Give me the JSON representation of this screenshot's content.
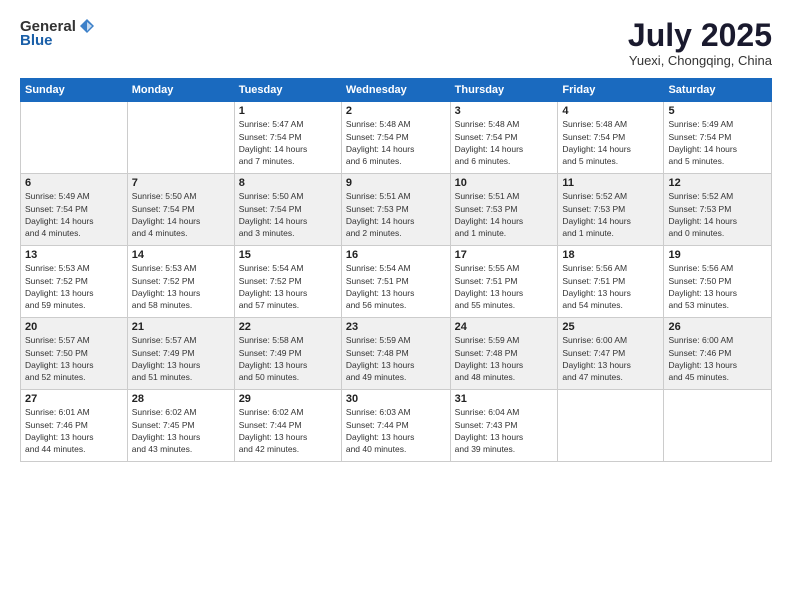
{
  "header": {
    "logo_general": "General",
    "logo_blue": "Blue",
    "title": "July 2025",
    "location": "Yuexi, Chongqing, China"
  },
  "weekdays": [
    "Sunday",
    "Monday",
    "Tuesday",
    "Wednesday",
    "Thursday",
    "Friday",
    "Saturday"
  ],
  "weeks": [
    [
      {
        "day": "",
        "detail": ""
      },
      {
        "day": "",
        "detail": ""
      },
      {
        "day": "1",
        "detail": "Sunrise: 5:47 AM\nSunset: 7:54 PM\nDaylight: 14 hours\nand 7 minutes."
      },
      {
        "day": "2",
        "detail": "Sunrise: 5:48 AM\nSunset: 7:54 PM\nDaylight: 14 hours\nand 6 minutes."
      },
      {
        "day": "3",
        "detail": "Sunrise: 5:48 AM\nSunset: 7:54 PM\nDaylight: 14 hours\nand 6 minutes."
      },
      {
        "day": "4",
        "detail": "Sunrise: 5:48 AM\nSunset: 7:54 PM\nDaylight: 14 hours\nand 5 minutes."
      },
      {
        "day": "5",
        "detail": "Sunrise: 5:49 AM\nSunset: 7:54 PM\nDaylight: 14 hours\nand 5 minutes."
      }
    ],
    [
      {
        "day": "6",
        "detail": "Sunrise: 5:49 AM\nSunset: 7:54 PM\nDaylight: 14 hours\nand 4 minutes."
      },
      {
        "day": "7",
        "detail": "Sunrise: 5:50 AM\nSunset: 7:54 PM\nDaylight: 14 hours\nand 4 minutes."
      },
      {
        "day": "8",
        "detail": "Sunrise: 5:50 AM\nSunset: 7:54 PM\nDaylight: 14 hours\nand 3 minutes."
      },
      {
        "day": "9",
        "detail": "Sunrise: 5:51 AM\nSunset: 7:53 PM\nDaylight: 14 hours\nand 2 minutes."
      },
      {
        "day": "10",
        "detail": "Sunrise: 5:51 AM\nSunset: 7:53 PM\nDaylight: 14 hours\nand 1 minute."
      },
      {
        "day": "11",
        "detail": "Sunrise: 5:52 AM\nSunset: 7:53 PM\nDaylight: 14 hours\nand 1 minute."
      },
      {
        "day": "12",
        "detail": "Sunrise: 5:52 AM\nSunset: 7:53 PM\nDaylight: 14 hours\nand 0 minutes."
      }
    ],
    [
      {
        "day": "13",
        "detail": "Sunrise: 5:53 AM\nSunset: 7:52 PM\nDaylight: 13 hours\nand 59 minutes."
      },
      {
        "day": "14",
        "detail": "Sunrise: 5:53 AM\nSunset: 7:52 PM\nDaylight: 13 hours\nand 58 minutes."
      },
      {
        "day": "15",
        "detail": "Sunrise: 5:54 AM\nSunset: 7:52 PM\nDaylight: 13 hours\nand 57 minutes."
      },
      {
        "day": "16",
        "detail": "Sunrise: 5:54 AM\nSunset: 7:51 PM\nDaylight: 13 hours\nand 56 minutes."
      },
      {
        "day": "17",
        "detail": "Sunrise: 5:55 AM\nSunset: 7:51 PM\nDaylight: 13 hours\nand 55 minutes."
      },
      {
        "day": "18",
        "detail": "Sunrise: 5:56 AM\nSunset: 7:51 PM\nDaylight: 13 hours\nand 54 minutes."
      },
      {
        "day": "19",
        "detail": "Sunrise: 5:56 AM\nSunset: 7:50 PM\nDaylight: 13 hours\nand 53 minutes."
      }
    ],
    [
      {
        "day": "20",
        "detail": "Sunrise: 5:57 AM\nSunset: 7:50 PM\nDaylight: 13 hours\nand 52 minutes."
      },
      {
        "day": "21",
        "detail": "Sunrise: 5:57 AM\nSunset: 7:49 PM\nDaylight: 13 hours\nand 51 minutes."
      },
      {
        "day": "22",
        "detail": "Sunrise: 5:58 AM\nSunset: 7:49 PM\nDaylight: 13 hours\nand 50 minutes."
      },
      {
        "day": "23",
        "detail": "Sunrise: 5:59 AM\nSunset: 7:48 PM\nDaylight: 13 hours\nand 49 minutes."
      },
      {
        "day": "24",
        "detail": "Sunrise: 5:59 AM\nSunset: 7:48 PM\nDaylight: 13 hours\nand 48 minutes."
      },
      {
        "day": "25",
        "detail": "Sunrise: 6:00 AM\nSunset: 7:47 PM\nDaylight: 13 hours\nand 47 minutes."
      },
      {
        "day": "26",
        "detail": "Sunrise: 6:00 AM\nSunset: 7:46 PM\nDaylight: 13 hours\nand 45 minutes."
      }
    ],
    [
      {
        "day": "27",
        "detail": "Sunrise: 6:01 AM\nSunset: 7:46 PM\nDaylight: 13 hours\nand 44 minutes."
      },
      {
        "day": "28",
        "detail": "Sunrise: 6:02 AM\nSunset: 7:45 PM\nDaylight: 13 hours\nand 43 minutes."
      },
      {
        "day": "29",
        "detail": "Sunrise: 6:02 AM\nSunset: 7:44 PM\nDaylight: 13 hours\nand 42 minutes."
      },
      {
        "day": "30",
        "detail": "Sunrise: 6:03 AM\nSunset: 7:44 PM\nDaylight: 13 hours\nand 40 minutes."
      },
      {
        "day": "31",
        "detail": "Sunrise: 6:04 AM\nSunset: 7:43 PM\nDaylight: 13 hours\nand 39 minutes."
      },
      {
        "day": "",
        "detail": ""
      },
      {
        "day": "",
        "detail": ""
      }
    ]
  ]
}
